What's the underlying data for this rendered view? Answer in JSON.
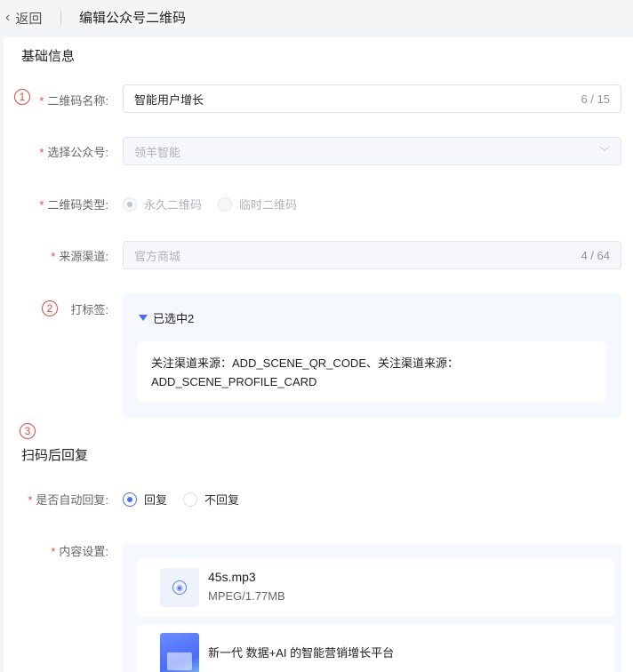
{
  "header": {
    "back_label": "返回",
    "title": "编辑公众号二维码"
  },
  "section_basic": {
    "title": "基础信息"
  },
  "markers": {
    "m1": "1",
    "m2": "2",
    "m3": "3"
  },
  "fields": {
    "name": {
      "label": "二维码名称:",
      "value": "智能用户增长",
      "count": "6 / 15"
    },
    "account": {
      "label": "选择公众号:",
      "value": "领羊智能"
    },
    "type": {
      "label": "二维码类型:",
      "options": [
        "永久二维码",
        "临时二维码"
      ],
      "selected": "永久二维码"
    },
    "channel": {
      "label": "来源渠道:",
      "value": "官方商城",
      "count": "4 / 64"
    },
    "tags": {
      "label": "打标签:",
      "toggle": "已选中2",
      "content_line1": "关注渠道来源：ADD_SCENE_QR_CODE、关注渠道来源：",
      "content_line2": "ADD_SCENE_PROFILE_CARD"
    }
  },
  "section_reply": {
    "title": "扫码后回复"
  },
  "reply": {
    "auto_label": "是否自动回复:",
    "options": [
      "回复",
      "不回复"
    ],
    "selected": "回复",
    "content_label": "内容设置:",
    "items": [
      {
        "name": "45s.mp3",
        "meta": "MPEG/1.77MB",
        "icon": "audio-icon"
      },
      {
        "title": "新一代 数据+AI 的智能营销增长平台",
        "icon": "article-thumbnail"
      }
    ]
  },
  "colors": {
    "primary": "#4a6cf7",
    "required": "#e04a3a",
    "panel": "#f5f8fd"
  }
}
